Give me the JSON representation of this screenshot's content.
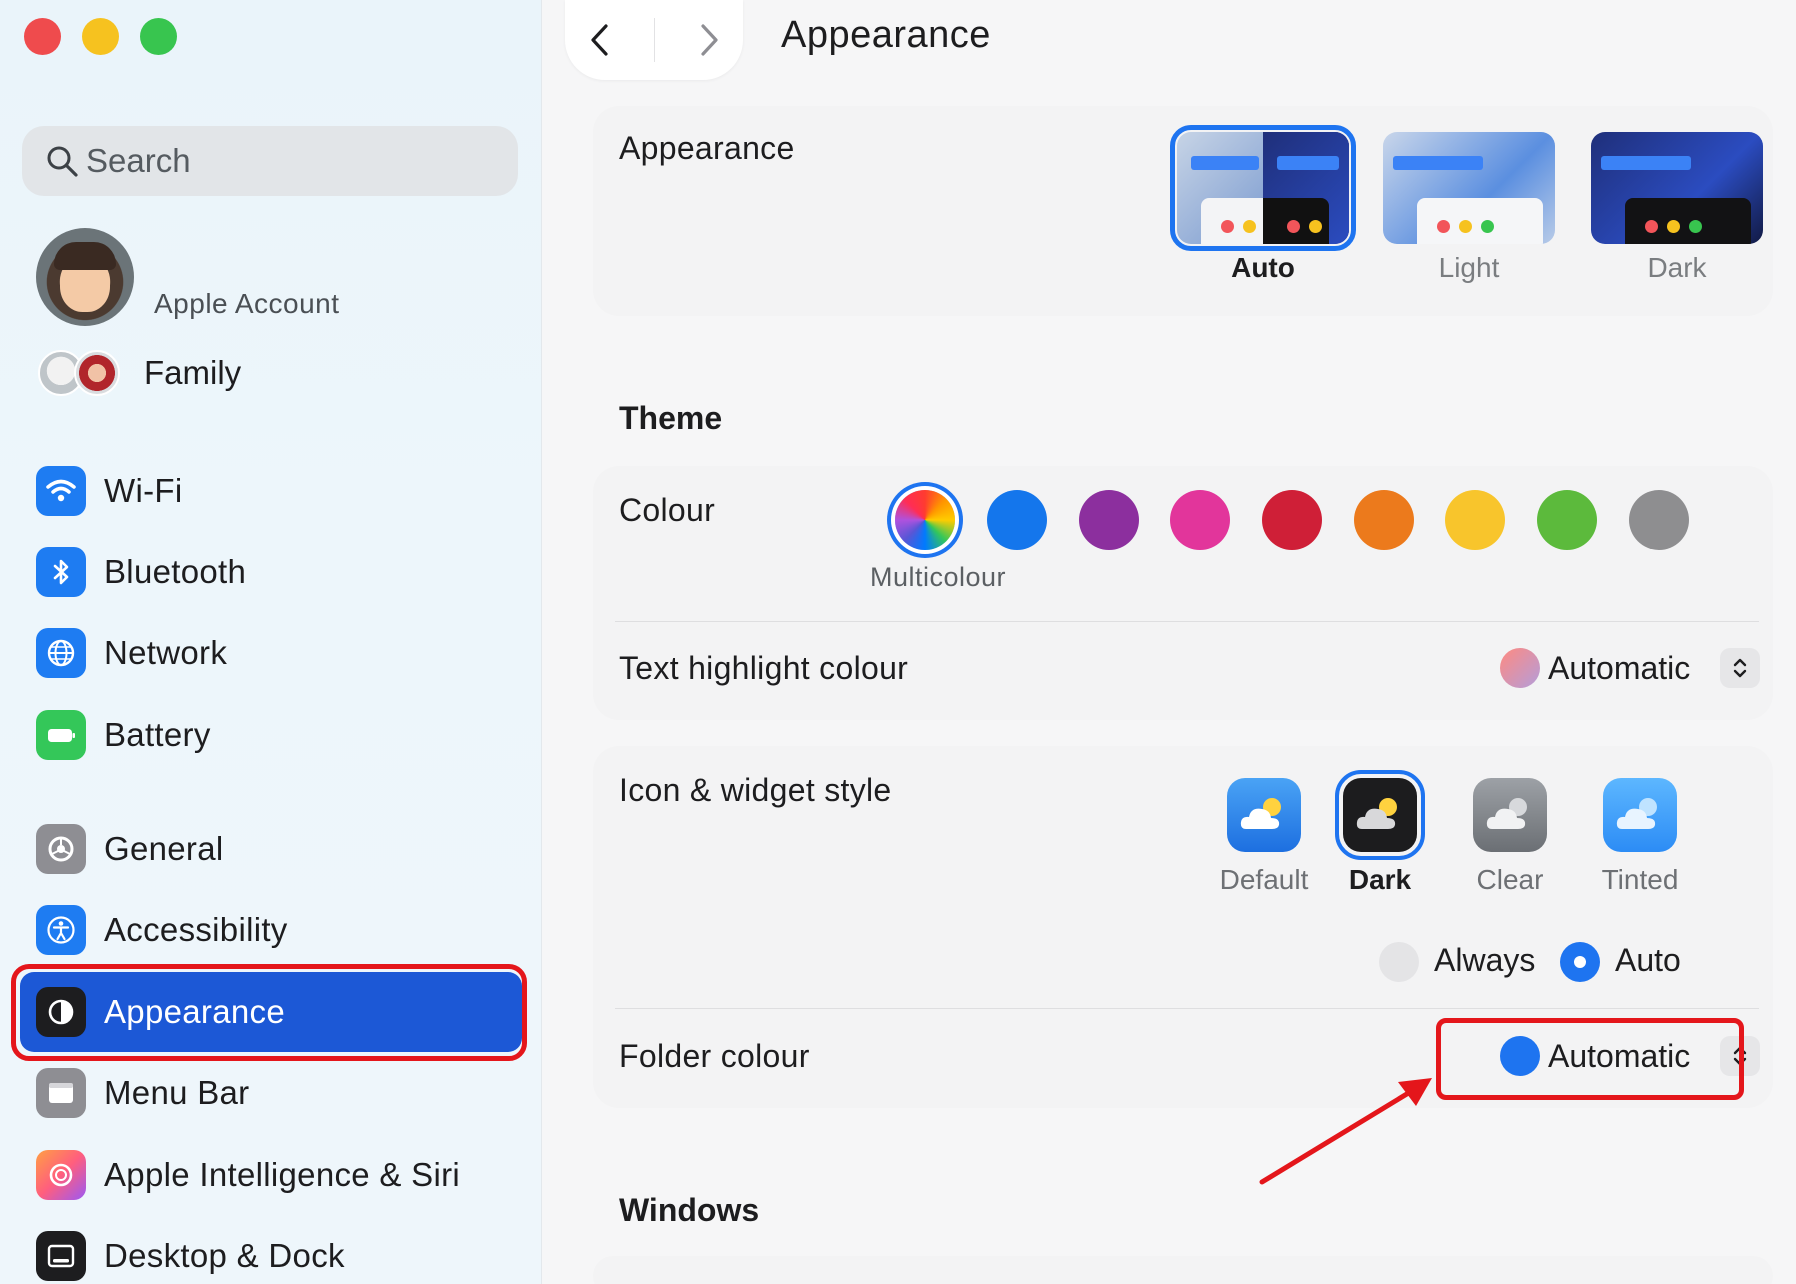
{
  "window": {
    "traffic_lights": [
      "close",
      "minimize",
      "zoom"
    ]
  },
  "sidebar": {
    "search_placeholder": "Search",
    "account_label": "Apple Account",
    "family_label": "Family",
    "items": [
      {
        "label": "Wi-Fi",
        "icon": "wifi-icon",
        "color": "#1e7cf2"
      },
      {
        "label": "Bluetooth",
        "icon": "bluetooth-icon",
        "color": "#1e7cf2"
      },
      {
        "label": "Network",
        "icon": "globe-icon",
        "color": "#1e7cf2"
      },
      {
        "label": "Battery",
        "icon": "battery-icon",
        "color": "#34c759"
      },
      {
        "label": "General",
        "icon": "gear-icon",
        "color": "#8e8e93"
      },
      {
        "label": "Accessibility",
        "icon": "accessibility-icon",
        "color": "#1e7cf2"
      },
      {
        "label": "Appearance",
        "icon": "appearance-icon",
        "color": "#1d1d1f",
        "active": true
      },
      {
        "label": "Menu Bar",
        "icon": "menubar-icon",
        "color": "#8e8e93"
      },
      {
        "label": "Apple Intelligence & Siri",
        "icon": "siri-icon",
        "color": "#ff6b6b"
      },
      {
        "label": "Desktop & Dock",
        "icon": "dock-icon",
        "color": "#1d1d1f"
      }
    ]
  },
  "header": {
    "title": "Appearance"
  },
  "appearance": {
    "label": "Appearance",
    "options": [
      {
        "label": "Auto",
        "selected": true
      },
      {
        "label": "Light",
        "selected": false
      },
      {
        "label": "Dark",
        "selected": false
      }
    ]
  },
  "theme": {
    "heading": "Theme",
    "colour_label": "Colour",
    "colours": [
      {
        "name": "Multicolour",
        "hex": "multi",
        "selected": true
      },
      {
        "name": "Blue",
        "hex": "#1476ec"
      },
      {
        "name": "Purple",
        "hex": "#8c2f9e"
      },
      {
        "name": "Pink",
        "hex": "#e2359b"
      },
      {
        "name": "Red",
        "hex": "#cf1f37"
      },
      {
        "name": "Orange",
        "hex": "#ec7a1c"
      },
      {
        "name": "Yellow",
        "hex": "#f8c52c"
      },
      {
        "name": "Green",
        "hex": "#5cba3c"
      },
      {
        "name": "Graphite",
        "hex": "#8e8e90"
      }
    ],
    "selected_colour_label": "Multicolour",
    "text_highlight_label": "Text highlight colour",
    "text_highlight_value": "Automatic"
  },
  "icon_widget": {
    "label": "Icon & widget style",
    "styles": [
      {
        "label": "Default",
        "selected": false
      },
      {
        "label": "Dark",
        "selected": true
      },
      {
        "label": "Clear",
        "selected": false
      },
      {
        "label": "Tinted",
        "selected": false
      }
    ],
    "mode_options": [
      {
        "label": "Always",
        "selected": false
      },
      {
        "label": "Auto",
        "selected": true
      }
    ],
    "folder_colour_label": "Folder colour",
    "folder_colour_value": "Automatic",
    "folder_colour_dot": "#1e74f0"
  },
  "windows": {
    "heading": "Windows"
  },
  "annotation": {
    "color": "#e4161b"
  }
}
